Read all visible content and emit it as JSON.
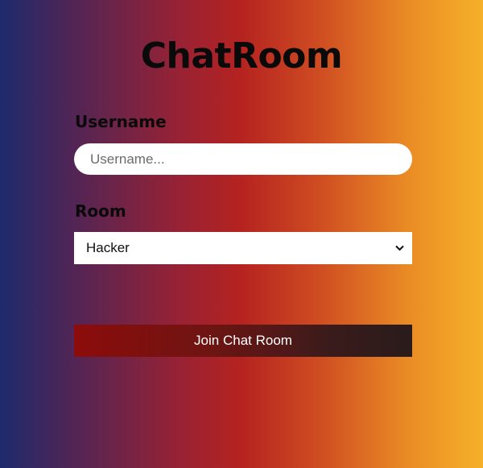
{
  "app": {
    "title": "ChatRoom"
  },
  "form": {
    "username_label": "Username",
    "username_placeholder": "Username...",
    "username_value": "",
    "room_label": "Room",
    "room_selected": "Hacker",
    "join_label": "Join Chat Room"
  },
  "icons": {
    "select_arrow": "chevron-down-icon"
  },
  "colors": {
    "gradient_left": "#1e2a6c",
    "gradient_middle": "#b52320",
    "gradient_right": "#f6b129",
    "button_start": "#8c0c0b",
    "button_end": "#2a1b1b"
  }
}
